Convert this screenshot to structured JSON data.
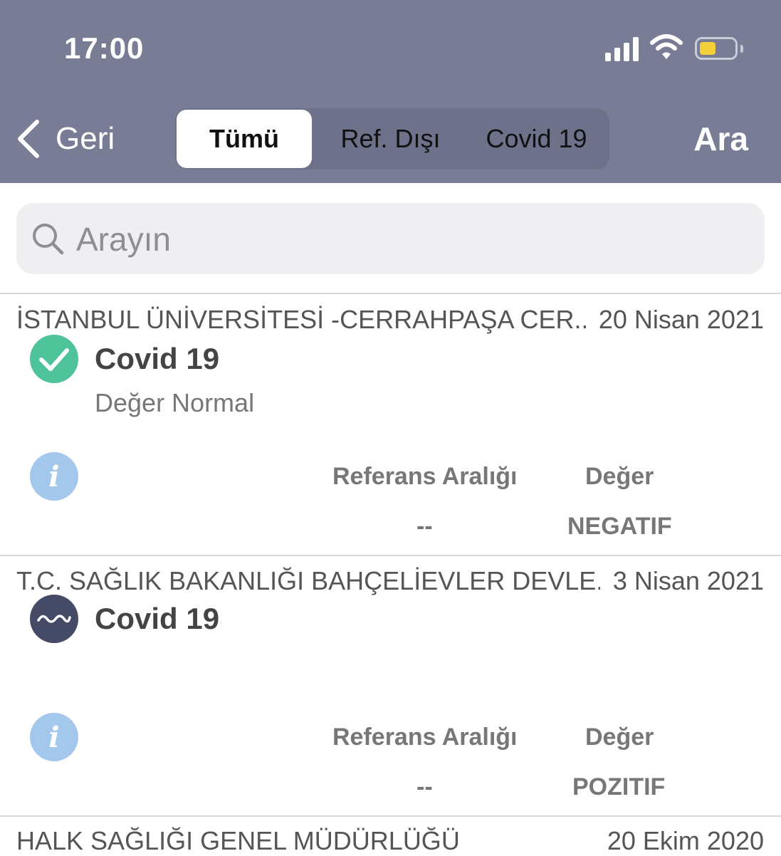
{
  "status_bar": {
    "time": "17:00"
  },
  "nav": {
    "back_label": "Geri",
    "tabs": [
      {
        "label": "Tümü",
        "active": true
      },
      {
        "label": "Ref. Dışı",
        "active": false
      },
      {
        "label": "Covid 19",
        "active": false
      }
    ],
    "search_label": "Ara"
  },
  "search": {
    "placeholder": "Arayın",
    "value": ""
  },
  "results": [
    {
      "hospital": "İSTANBUL ÜNİVERSİTESİ -CERRAHPAŞA CER...",
      "date": "20 Nisan 2021",
      "test_name": "Covid 19",
      "status_text": "Değer Normal",
      "status_icon": "check-circle-icon",
      "ref_header": "Referans Aralığı",
      "value_header": "Değer",
      "ref_value": "--",
      "value": "NEGATIF"
    },
    {
      "hospital": "T.C. SAĞLIK BAKANLIĞI BAHÇELİEVLER DEVLE...",
      "date": "3 Nisan 2021",
      "test_name": "Covid 19",
      "status_text": "",
      "status_icon": "wave-circle-icon",
      "ref_header": "Referans Aralığı",
      "value_header": "Değer",
      "ref_value": "--",
      "value": "POZITIF"
    },
    {
      "hospital": "HALK SAĞLIĞI GENEL MÜDÜRLÜĞÜ",
      "date": "20 Ekim 2020"
    }
  ],
  "colors": {
    "header_bg": "#787c94",
    "check_green": "#4fc39a",
    "wave_dark": "#454a66",
    "info_blue": "#a4c8ec"
  }
}
